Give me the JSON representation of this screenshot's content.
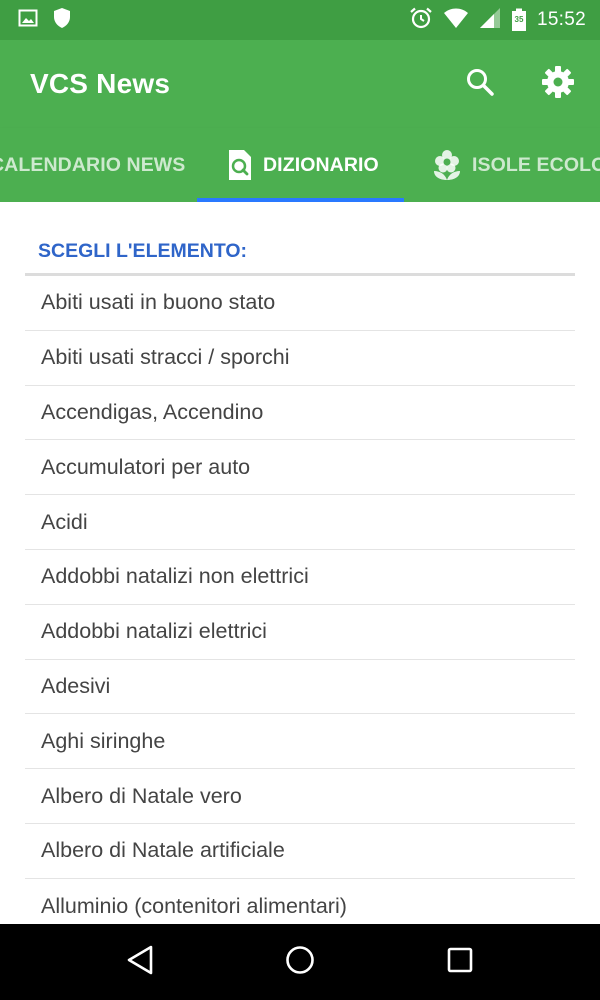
{
  "status_bar": {
    "time": "15:52",
    "battery_level": "35",
    "left_icons": [
      "image-icon",
      "shield-icon"
    ],
    "right_icons": [
      "alarm-icon",
      "wifi-icon",
      "signal-icon",
      "battery-icon"
    ]
  },
  "toolbar": {
    "title": "VCS News",
    "actions": [
      "search-icon",
      "settings-icon"
    ]
  },
  "tabs": [
    {
      "label": "CALENDARIO NEWS",
      "active": false
    },
    {
      "label": "DIZIONARIO",
      "active": true
    },
    {
      "label": "ISOLE ECOLOGICHE",
      "active": false
    }
  ],
  "dictionary": {
    "header": "SCEGLI L'ELEMENTO:",
    "items": [
      "Abiti usati in buono stato",
      "Abiti usati stracci / sporchi",
      "Accendigas, Accendino",
      "Accumulatori per auto",
      "Acidi",
      "Addobbi natalizi non elettrici",
      "Addobbi natalizi elettrici",
      "Adesivi",
      "Aghi siringhe",
      "Albero di Natale vero",
      "Albero di Natale artificiale",
      "Alluminio (contenitori alimentari)"
    ]
  },
  "colors": {
    "status_bar": "#3f9e43",
    "toolbar": "#4caf50",
    "tab_indicator": "#2979ff",
    "section_title": "#2f65c9",
    "list_text": "#444444"
  },
  "nav_bar": [
    "back-icon",
    "home-icon",
    "recents-icon"
  ]
}
